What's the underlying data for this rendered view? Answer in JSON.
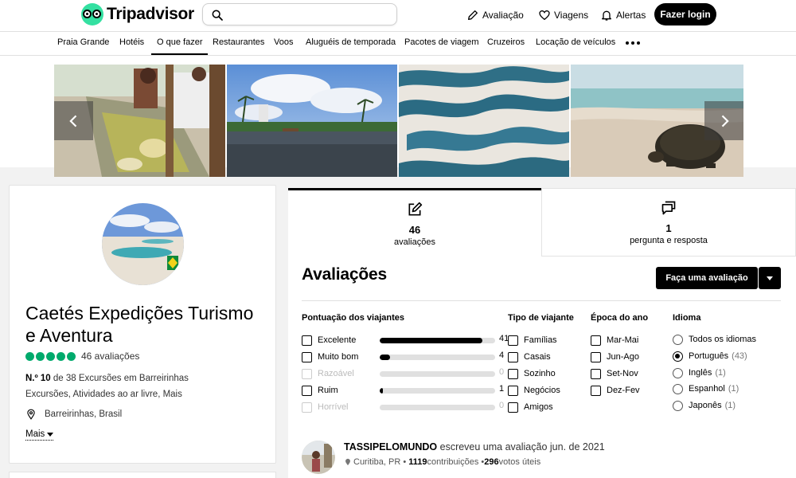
{
  "header": {
    "brand": "Tripadvisor",
    "search_placeholder": "",
    "nav": [
      {
        "label": "Avaliação",
        "icon": "pencil-icon"
      },
      {
        "label": "Viagens",
        "icon": "heart-icon"
      },
      {
        "label": "Alertas",
        "icon": "bell-icon"
      }
    ],
    "login_label": "Fazer login"
  },
  "subnav": {
    "items": [
      "Praia Grande",
      "Hotéis",
      "O que fazer",
      "Restaurantes",
      "Voos",
      "Aluguéis de temporada",
      "Pacotes de viagem",
      "Cruzeiros",
      "Locação de veículos"
    ],
    "active_index": 2
  },
  "business": {
    "name": "Caetés Expedições Turismo e Aventura",
    "review_count_label": "46 avaliações",
    "rating_bubbles": 5,
    "rank_bold": "N.º 10",
    "rank_rest": " de 38 Excursões em Barreirinhas",
    "categories": "Excursões, Atividades ao ar livre, Mais",
    "location": "Barreirinhas, Brasil",
    "more_label": "Mais"
  },
  "tabs": [
    {
      "count": "46",
      "label": "avaliações",
      "icon": "write-review-icon"
    },
    {
      "count": "1",
      "label": "pergunta e resposta",
      "icon": "qa-icon"
    }
  ],
  "reviews": {
    "title": "Avaliações",
    "write_button": "Faça uma avaliação",
    "filters": {
      "rating_title": "Pontuação dos viajantes",
      "ratings": [
        {
          "label": "Excelente",
          "count": 41,
          "enabled": true
        },
        {
          "label": "Muito bom",
          "count": 4,
          "enabled": true
        },
        {
          "label": "Razoável",
          "count": 0,
          "enabled": false
        },
        {
          "label": "Ruim",
          "count": 1,
          "enabled": true
        },
        {
          "label": "Horrível",
          "count": 0,
          "enabled": false
        }
      ],
      "traveler_title": "Tipo de viajante",
      "traveler_types": [
        "Famílias",
        "Casais",
        "Sozinho",
        "Negócios",
        "Amigos"
      ],
      "season_title": "Época do ano",
      "seasons": [
        "Mar-Mai",
        "Jun-Ago",
        "Set-Nov",
        "Dez-Fev"
      ],
      "language_title": "Idioma",
      "languages": [
        {
          "label": "Todos os idiomas",
          "count": "",
          "selected": false
        },
        {
          "label": "Português",
          "count": "(43)",
          "selected": true
        },
        {
          "label": "Inglês",
          "count": "(1)",
          "selected": false
        },
        {
          "label": "Espanhol",
          "count": "(1)",
          "selected": false
        },
        {
          "label": "Japonês",
          "count": "(1)",
          "selected": false
        }
      ]
    },
    "first_review": {
      "username": "TASSIPELOMUNDO",
      "action": " escreveu uma avaliação jun. de 2021",
      "location": "Curitiba, PR",
      "contributions": "1119",
      "contributions_label": " contribuições • ",
      "votes": "296",
      "votes_label": " votos úteis"
    }
  }
}
